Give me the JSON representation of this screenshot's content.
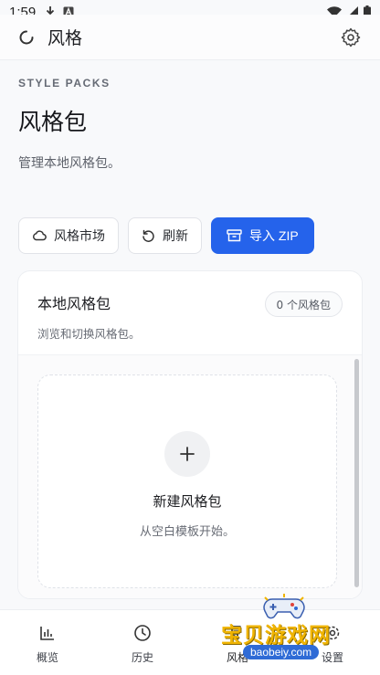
{
  "status_bar": {
    "time": "1:59",
    "icons": [
      "download-icon",
      "a-box-icon",
      "wifi-icon",
      "cell-signal-icon",
      "battery-icon"
    ]
  },
  "app_bar": {
    "title": "风格",
    "logo_icon": "loading-ring-icon",
    "settings_icon": "gear-icon"
  },
  "header": {
    "eyebrow": "STYLE PACKS",
    "title": "风格包",
    "subtitle": "管理本地风格包。"
  },
  "actions": {
    "market_label": "风格市场",
    "market_icon": "cloud-icon",
    "refresh_label": "刷新",
    "refresh_icon": "refresh-icon",
    "import_label": "导入 ZIP",
    "import_icon": "archive-box-icon"
  },
  "local_packs": {
    "title": "本地风格包",
    "description": "浏览和切换风格包。",
    "count_badge": "0 个风格包",
    "new_pack_title": "新建风格包",
    "new_pack_description": "从空白模板开始。"
  },
  "bottom_nav": {
    "items": [
      {
        "label": "概览",
        "icon": "bar-chart-icon"
      },
      {
        "label": "历史",
        "icon": "clock-icon"
      },
      {
        "label": "风格",
        "icon": "palette-icon",
        "active": true
      },
      {
        "label": "设置",
        "icon": "settings-icon"
      }
    ]
  },
  "watermark": {
    "text": "宝贝游戏网",
    "url": "baobeiy.com"
  },
  "colors": {
    "accent": "#2563eb",
    "background": "#f8f9fb"
  }
}
